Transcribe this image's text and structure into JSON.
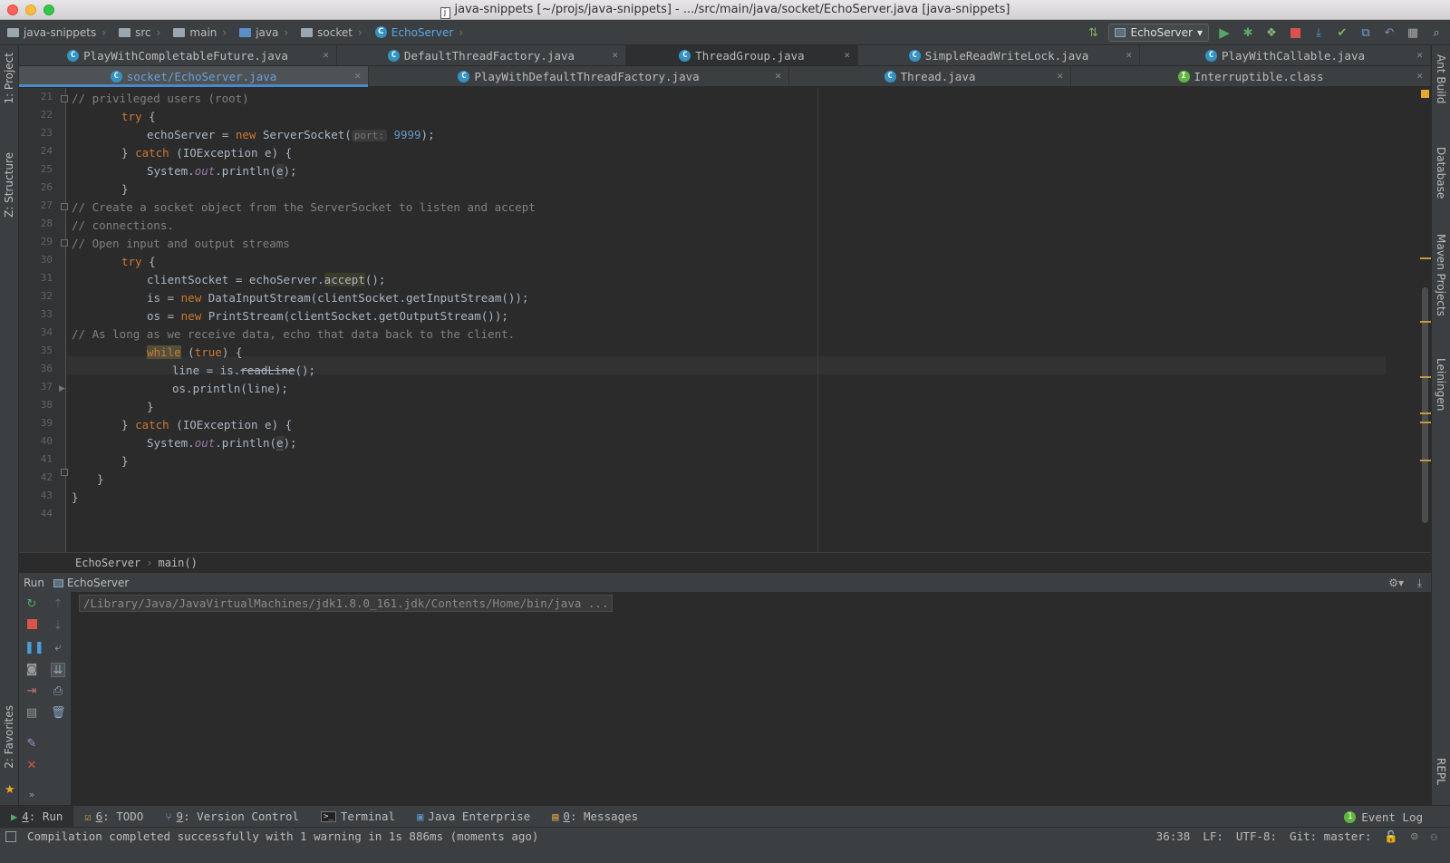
{
  "window": {
    "title": "java-snippets [~/projs/java-snippets] - .../src/main/java/socket/EchoServer.java [java-snippets]",
    "file_badge": "j"
  },
  "navbar": {
    "crumbs": [
      "java-snippets",
      "src",
      "main",
      "java",
      "socket",
      "EchoServer"
    ],
    "run_config": "EchoServer"
  },
  "left_tools": [
    "1: Project",
    "Z: Structure",
    "2: Favorites"
  ],
  "right_tools": [
    "Ant Build",
    "Database",
    "Maven Projects",
    "Leiningen",
    "REPL"
  ],
  "tabs_row1": [
    {
      "label": "PlayWithCompletableFuture.java",
      "icon": "C"
    },
    {
      "label": "DefaultThreadFactory.java",
      "icon": "C"
    },
    {
      "label": "ThreadGroup.java",
      "icon": "C"
    },
    {
      "label": "SimpleReadWriteLock.java",
      "icon": "C"
    },
    {
      "label": "PlayWithCallable.java",
      "icon": "C"
    }
  ],
  "tabs_row2": [
    {
      "label": "socket/EchoServer.java",
      "icon": "C"
    },
    {
      "label": "PlayWithDefaultThreadFactory.java",
      "icon": "C"
    },
    {
      "label": "Thread.java",
      "icon": "C"
    },
    {
      "label": "Interruptible.class",
      "icon": "I"
    }
  ],
  "editor": {
    "line_numbers": [
      "21",
      "22",
      "23",
      "24",
      "25",
      "26",
      "27",
      "28",
      "29",
      "30",
      "31",
      "32",
      "33",
      "34",
      "35",
      "36",
      "37",
      "38",
      "39",
      "40",
      "41",
      "42",
      "43",
      "44"
    ],
    "code": {
      "l21": "// privileged users (root)",
      "l22_kw": "try",
      "l22_rest": " {",
      "l23_a": "echoServer = ",
      "l23_kw": "new",
      "l23_b": " ServerSocket(",
      "l23_hint": "port:",
      "l23_num": "9999",
      "l23_c": ");",
      "l24_a": "} ",
      "l24_kw": "catch",
      "l24_b": " (IOException e) {",
      "l25_a": "System.",
      "l25_field": "out",
      "l25_b": ".println(",
      "l25_e": "e",
      "l25_c": ");",
      "l26": "}",
      "l27": "// Create a socket object from the ServerSocket to listen and accept",
      "l28": "// connections.",
      "l29": "// Open input and output streams",
      "l30_kw": "try",
      "l30_rest": " {",
      "l31_a": "clientSocket = echoServer.",
      "l31_hl": "accept",
      "l31_b": "();",
      "l32_a": "is = ",
      "l32_kw": "new",
      "l32_b": " DataInputStream(clientSocket.getInputStream());",
      "l33_a": "os = ",
      "l33_kw": "new",
      "l33_b": " PrintStream(clientSocket.getOutputStream());",
      "l34": "// As long as we receive data, echo that data back to the client.",
      "l35_kw": "while",
      "l35_a": " (",
      "l35_kw2": "true",
      "l35_b": ") {",
      "l36_a": "line = is.",
      "l36_strike": "readLine",
      "l36_b": "();",
      "l37": "os.println(line);",
      "l38": "}",
      "l39_a": "} ",
      "l39_kw": "catch",
      "l39_b": " (IOException e) {",
      "l40_a": "System.",
      "l40_field": "out",
      "l40_b": ".println(",
      "l40_e": "e",
      "l40_c": ");",
      "l41": "}",
      "l42": "}",
      "l43": "}"
    },
    "breadcrumbs": [
      "EchoServer",
      "main()"
    ]
  },
  "run_panel": {
    "label": "Run",
    "config": "EchoServer",
    "console_line": "/Library/Java/JavaVirtualMachines/jdk1.8.0_161.jdk/Contents/Home/bin/java ..."
  },
  "tool_tabs": [
    {
      "num": "4",
      "label": ": Run"
    },
    {
      "num": "6",
      "label": ": TODO"
    },
    {
      "num": "9",
      "label": ": Version Control"
    },
    {
      "num": "",
      "label": "Terminal"
    },
    {
      "num": "",
      "label": "Java Enterprise"
    },
    {
      "num": "0",
      "label": ": Messages"
    }
  ],
  "event_log": "Event Log",
  "status": {
    "message": "Compilation completed successfully with 1 warning in 1s 886ms (moments ago)",
    "position": "36:38",
    "line_sep": "LF:",
    "encoding": "UTF-8:",
    "git": "Git: master:"
  }
}
